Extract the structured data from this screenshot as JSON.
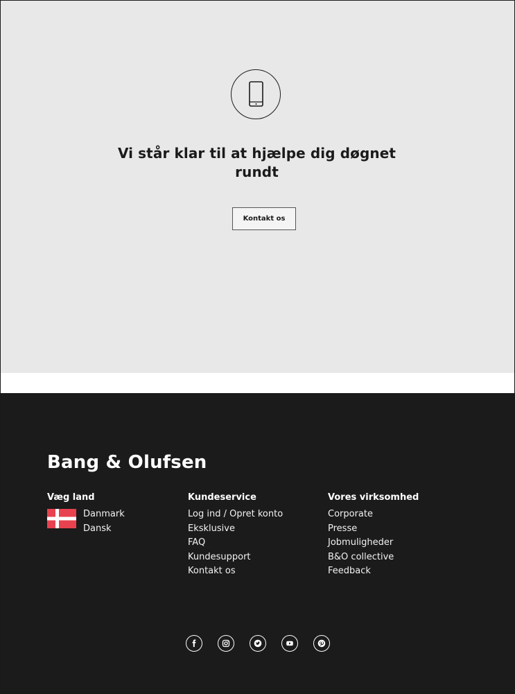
{
  "hero": {
    "icon": "mobile-phone-icon",
    "title": "Vi står klar til at hjælpe dig døgnet rundt",
    "button_label": "Kontakt os"
  },
  "footer": {
    "brand": "Bang & Olufsen",
    "country": {
      "heading": "Væg land",
      "flag_icon": "denmark-flag-icon",
      "country_name": "Danmark",
      "language": "Dansk"
    },
    "customer_service": {
      "heading": "Kundeservice",
      "links": [
        "Log ind / Opret konto",
        "Eksklusive",
        "FAQ",
        "Kundesupport",
        "Kontakt os"
      ]
    },
    "company": {
      "heading": "Vores virksomhed",
      "links": [
        "Corporate",
        "Presse",
        "Jobmuligheder",
        "B&O collective",
        "Feedback"
      ]
    },
    "social": [
      "facebook-icon",
      "instagram-icon",
      "twitter-icon",
      "youtube-icon",
      "pinterest-icon"
    ]
  },
  "colors": {
    "hero_bg": "#e8e8e8",
    "footer_bg": "#1b1b1b",
    "flag_red": "#e8424f"
  }
}
